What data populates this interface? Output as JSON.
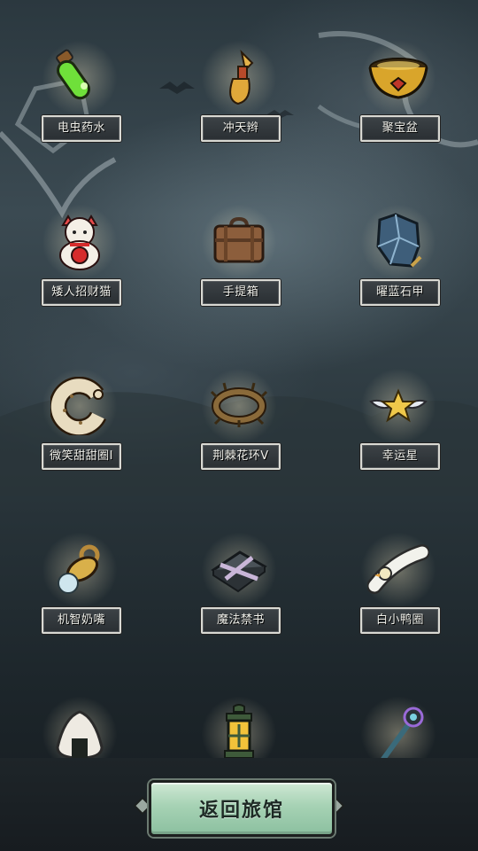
{
  "items": [
    {
      "name": "电虫药水",
      "icon": "green-potion-icon"
    },
    {
      "name": "冲天辫",
      "icon": "ponytail-icon"
    },
    {
      "name": "聚宝盆",
      "icon": "treasure-bowl-icon"
    },
    {
      "name": "矮人招财猫",
      "icon": "lucky-cat-icon"
    },
    {
      "name": "手提箱",
      "icon": "suitcase-icon"
    },
    {
      "name": "曜蓝石甲",
      "icon": "blue-stone-armor-icon"
    },
    {
      "name": "微笑甜甜圈I",
      "icon": "donut-icon"
    },
    {
      "name": "荆棘花环V",
      "icon": "thorn-wreath-icon"
    },
    {
      "name": "幸运星",
      "icon": "lucky-star-icon"
    },
    {
      "name": "机智奶嘴",
      "icon": "pacifier-icon"
    },
    {
      "name": "魔法禁书",
      "icon": "forbidden-book-icon"
    },
    {
      "name": "白小鸭圈",
      "icon": "duck-ring-icon"
    },
    {
      "name": "",
      "icon": "rice-ball-icon"
    },
    {
      "name": "",
      "icon": "lantern-icon"
    },
    {
      "name": "",
      "icon": "magic-staff-icon"
    }
  ],
  "back_button": {
    "label": "返回旅馆"
  },
  "colors": {
    "button": "#a6d2b4",
    "label_bg": "#2f3437",
    "label_border": "#d9d9d3"
  }
}
